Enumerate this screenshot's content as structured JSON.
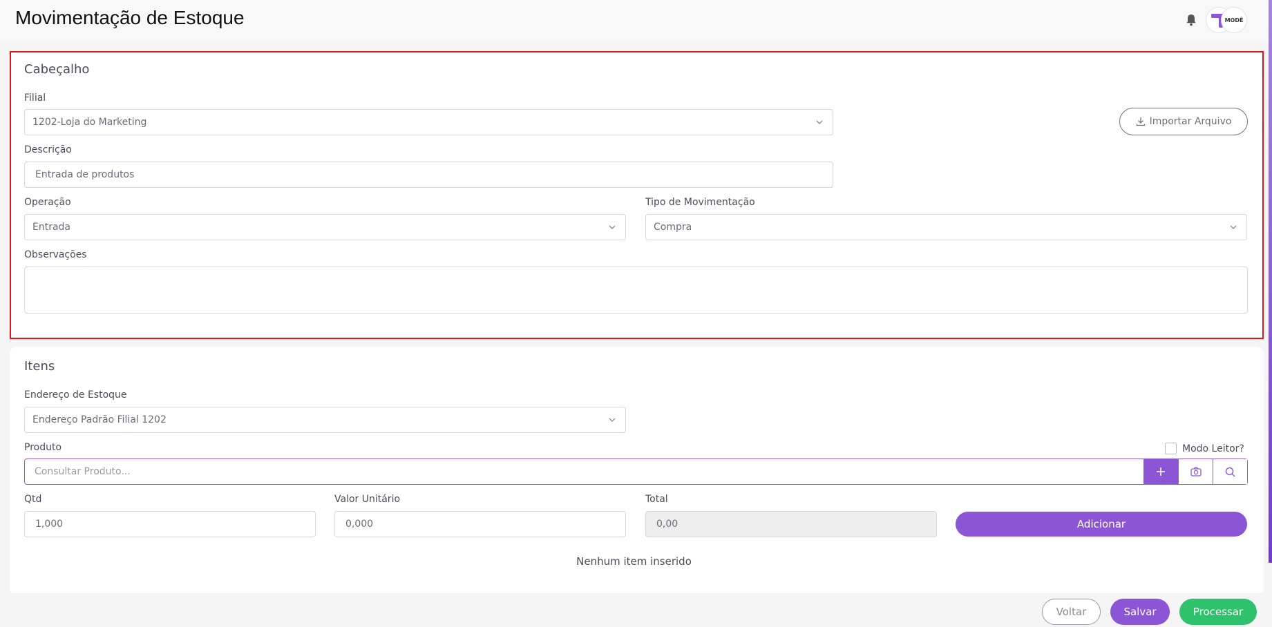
{
  "page": {
    "title": "Movimentação de Estoque"
  },
  "header_user": {
    "avatar_text": "MODÊ"
  },
  "header_section": {
    "title": "Cabeçalho",
    "filial": {
      "label": "Filial",
      "value": "1202-Loja do Marketing"
    },
    "import_button": "Importar Arquivo",
    "descricao": {
      "label": "Descrição",
      "value": "Entrada de produtos"
    },
    "operacao": {
      "label": "Operação",
      "value": "Entrada"
    },
    "tipo_movimentacao": {
      "label": "Tipo de Movimentação",
      "value": "Compra"
    },
    "observacoes": {
      "label": "Observações",
      "value": ""
    }
  },
  "items_section": {
    "title": "Itens",
    "endereco": {
      "label": "Endereço de Estoque",
      "value": "Endereço Padrão Filial 1202"
    },
    "produto": {
      "label": "Produto",
      "placeholder": "Consultar Produto..."
    },
    "modo_leitor": "Modo Leitor?",
    "qtd": {
      "label": "Qtd",
      "value": "1,000"
    },
    "valor_unitario": {
      "label": "Valor Unitário",
      "value": "0,000"
    },
    "total": {
      "label": "Total",
      "value": "0,00"
    },
    "add_button": "Adicionar",
    "empty_message": "Nenhum item inserido"
  },
  "footer": {
    "back": "Voltar",
    "save": "Salvar",
    "process": "Processar"
  },
  "colors": {
    "primary": "#8b55d5",
    "success": "#2fc26c",
    "highlight": "#e3141c"
  }
}
